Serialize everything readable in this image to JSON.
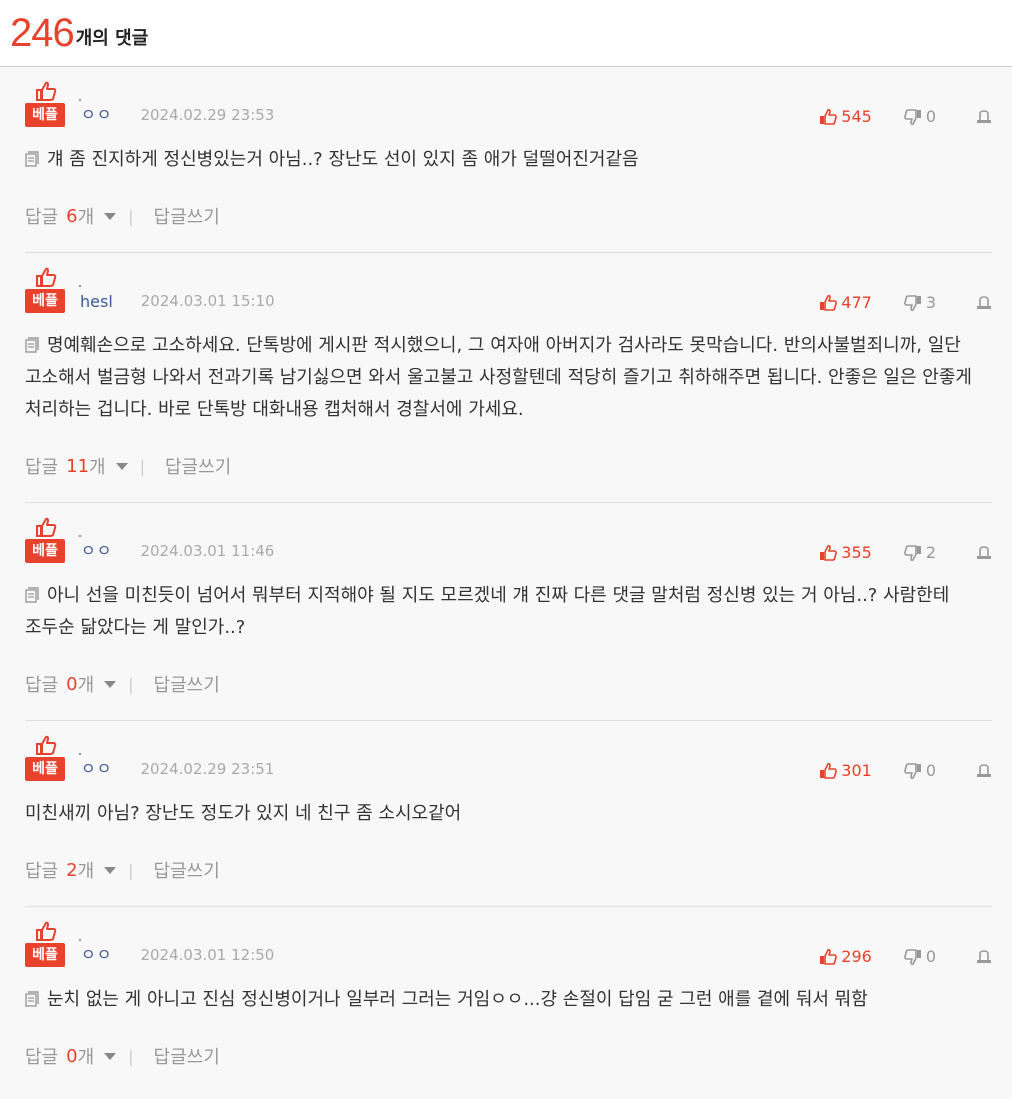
{
  "header": {
    "count": "246",
    "suffix": "개의 댓글"
  },
  "icons": {
    "thumb_up": "thumbs-up-icon",
    "thumb_down": "thumbs-down-icon",
    "report": "report-icon",
    "doc": "document-icon"
  },
  "colors": {
    "accent": "#e8412c",
    "nick": "#3b5998",
    "muted": "#999999"
  },
  "labels": {
    "best": "베플",
    "reply": "답글",
    "reply_unit": "개",
    "write_reply": "답글쓰기"
  },
  "comments": [
    {
      "nick": "ㅇㅇ",
      "date": "2024.02.29 23:53",
      "up": "545",
      "down": "0",
      "has_icon": true,
      "text": "걔 좀 진지하게 정신병있는거 아님..? 장난도 선이 있지 좀 애가 덜떨어진거같음",
      "replies": "6"
    },
    {
      "nick": "hesl",
      "date": "2024.03.01 15:10",
      "up": "477",
      "down": "3",
      "has_icon": true,
      "text": "명예훼손으로 고소하세요. 단톡방에 게시판 적시했으니, 그 여자애 아버지가 검사라도 못막습니다. 반의사불벌죄니까, 일단 고소해서 벌금형 나와서 전과기록 남기싫으면 와서 울고불고 사정할텐데 적당히 즐기고 취하해주면 됩니다. 안좋은 일은 안좋게 처리하는 겁니다. 바로 단톡방 대화내용 캡처해서 경찰서에 가세요.",
      "replies": "11"
    },
    {
      "nick": "ㅇㅇ",
      "date": "2024.03.01 11:46",
      "up": "355",
      "down": "2",
      "has_icon": true,
      "text": "아니 선을 미친듯이 넘어서 뭐부터 지적해야 될 지도 모르겠네 걔 진짜 다른 댓글 말처럼 정신병 있는 거 아님..? 사람한테 조두순 닮았다는 게 말인가..?",
      "replies": "0"
    },
    {
      "nick": "ㅇㅇ",
      "date": "2024.02.29 23:51",
      "up": "301",
      "down": "0",
      "has_icon": false,
      "text": "미친새끼 아님? 장난도 정도가 있지 네 친구 좀 소시오같어",
      "replies": "2"
    },
    {
      "nick": "ㅇㅇ",
      "date": "2024.03.01 12:50",
      "up": "296",
      "down": "0",
      "has_icon": true,
      "text": "눈치 없는 게 아니고 진심 정신병이거나 일부러 그러는 거임ㅇㅇ...걍 손절이 답임 굳 그런 애를 곁에 둬서 뭐함",
      "replies": "0"
    }
  ]
}
